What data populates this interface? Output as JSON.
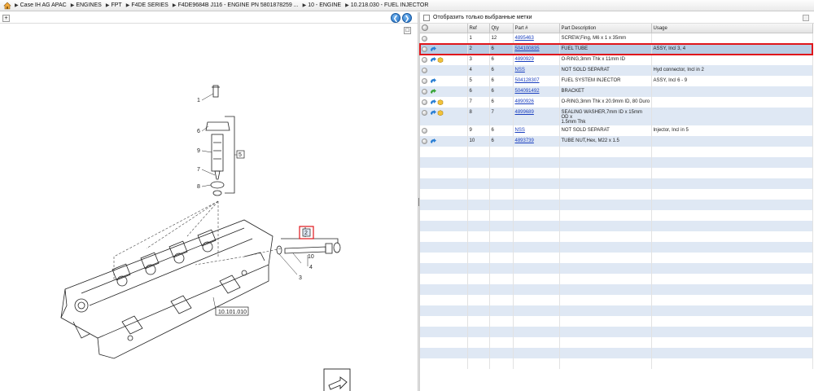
{
  "breadcrumb": [
    "Case IH AG APAC",
    "ENGINES",
    "FPT",
    "F4DE SERIES",
    "F4DE9684B J116 - ENGINE PN 5801878259 ...",
    "10 - ENGINE",
    "10.218.030 - FUEL INJECTOR"
  ],
  "filter": {
    "label": "Отобразить только выбранные метки"
  },
  "table": {
    "headers": [
      "",
      "Ref",
      "Qty",
      "Part #",
      "Part Description",
      "Usage"
    ],
    "rows": [
      {
        "ref": "1",
        "qty": "12",
        "part": "4895463",
        "desc": "SCREW,Fing, M6 x 1 x 35mm",
        "usage": "",
        "icons": []
      },
      {
        "ref": "2",
        "qty": "6",
        "part": "504100835",
        "desc": "FUEL TUBE",
        "usage": "ASSY, Incl 3, 4",
        "icons": [
          "blue-arrow-icon"
        ]
      },
      {
        "ref": "3",
        "qty": "6",
        "part": "4890929",
        "desc": "O-RING,3mm Thk x 11mm ID",
        "usage": "",
        "icons": [
          "blue-arrow-icon",
          "yellow-package-icon"
        ]
      },
      {
        "ref": "4",
        "qty": "6",
        "part": "NSS",
        "desc": "NOT SOLD SEPARAT",
        "usage": "Hyd connector, Incl in 2",
        "icons": []
      },
      {
        "ref": "5",
        "qty": "6",
        "part": "504128307",
        "desc": "FUEL SYSTEM INJECTOR",
        "usage": "ASSY, Incl 6 - 9",
        "icons": [
          "blue-arrow-icon"
        ]
      },
      {
        "ref": "6",
        "qty": "6",
        "part": "504091492",
        "desc": "BRACKET",
        "usage": "",
        "icons": [
          "green-arrow-icon"
        ]
      },
      {
        "ref": "7",
        "qty": "6",
        "part": "4890926",
        "desc": "O-RING,3mm Thk x 20.9mm ID, 80 Duro",
        "usage": "",
        "icons": [
          "blue-arrow-icon",
          "yellow-package-icon"
        ]
      },
      {
        "ref": "8",
        "qty": "7",
        "part": "4899689",
        "desc": "SEALING WASHER,7mm ID x 15mm OD x",
        "desc2": "1.5mm Thk",
        "usage": "",
        "icons": [
          "blue-arrow-icon",
          "yellow-package-icon"
        ]
      },
      {
        "ref": "9",
        "qty": "6",
        "part": "NSS",
        "desc": "NOT SOLD SEPARAT",
        "usage": "Injector, Incl in 5",
        "icons": []
      },
      {
        "ref": "10",
        "qty": "6",
        "part": "4893739",
        "desc": "TUBE NUT,Hex, M22 x 1.5",
        "usage": "",
        "icons": [
          "blue-arrow-icon"
        ]
      }
    ],
    "empty_rows": 21,
    "selected_ref": "2"
  },
  "diagram": {
    "callouts": [
      "1",
      "6",
      "9",
      "7",
      "8",
      "5",
      "2",
      "10",
      "4",
      "3"
    ],
    "ref_box_5": "5",
    "ref_box_2": "2",
    "group_ref": "10.101.010"
  },
  "colors": {
    "selected_row": "#b9cde4",
    "selected_border": "#e0161b",
    "link": "#1a3fbf",
    "stripe": "#dfe8f4"
  }
}
